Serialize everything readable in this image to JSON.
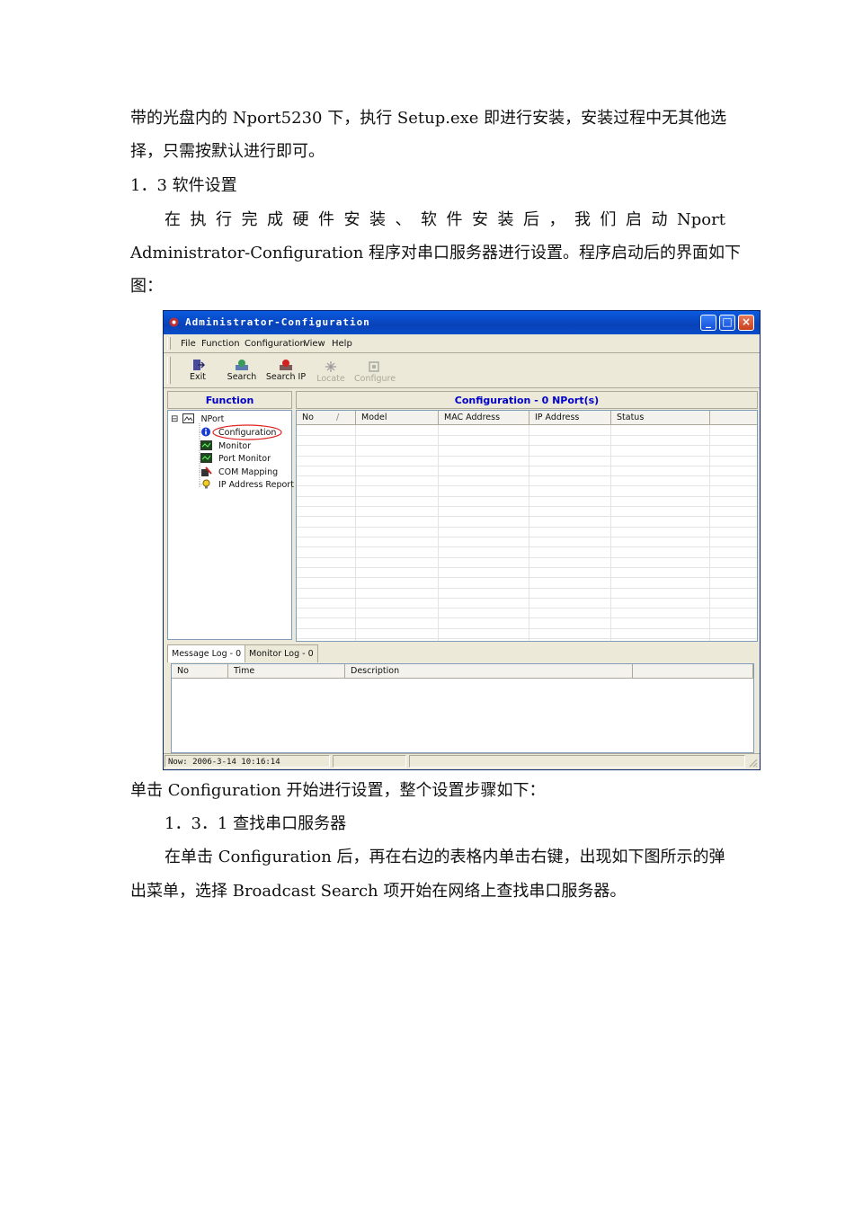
{
  "doc": {
    "line1": "带的光盘内的 Nport5230 下，执行 Setup.exe 即进行安装，安装过程中无其他选",
    "line2": "择，只需按默认进行即可。",
    "heading13": "1．3 软件设置",
    "line4_chars": [
      "在",
      "执",
      "行",
      "完",
      "成",
      "硬",
      "件",
      "安",
      "装",
      "、",
      "软",
      "件",
      "安",
      "装",
      "后",
      "，",
      "我",
      "们",
      "启",
      "动",
      "Nport"
    ],
    "line5": "Administrator-Configuration 程序对串口服务器进行设置。程序启动后的界面如下",
    "line6": "图：",
    "after1": "单击 Configuration 开始进行设置，整个设置步骤如下：",
    "heading131": "1．3．1  查找串口服务器",
    "after2": "在单击 Configuration 后，再在右边的表格内单击右键，出现如下图所示的弹",
    "after3": "出菜单，选择 Broadcast Search 项开始在网络上查找串口服务器。"
  },
  "window": {
    "title": "Administrator-Configuration",
    "min_glyph": "_",
    "max_glyph": "□",
    "close_glyph": "×",
    "menu": [
      "File",
      "Function",
      "Configuration",
      "View",
      "Help"
    ],
    "toolbar": {
      "exit": "Exit",
      "search": "Search",
      "search_ip": "Search IP",
      "locate": "Locate",
      "configure": "Configure"
    },
    "left_header": "Function",
    "tree": {
      "expander": "⊟",
      "root": "NPort",
      "items": [
        "Configuration",
        "Monitor",
        "Port Monitor",
        "COM Mapping",
        "IP Address Report"
      ]
    },
    "grid_header": "Configuration - 0 NPort(s)",
    "columns": [
      "No",
      "Model",
      "MAC Address",
      "IP Address",
      "Status"
    ],
    "sort_indicator": "/",
    "tabs": [
      "Message Log - 0",
      "Monitor Log - 0"
    ],
    "log_columns": [
      "No",
      "Time",
      "Description"
    ],
    "status": "Now: 2006-3-14 10:16:14"
  },
  "colors": {
    "title_bar": "#0a4dc9",
    "pane_header_text": "#0000c8",
    "highlight_ellipse": "#e02020",
    "window_bg": "#ece9d8"
  }
}
